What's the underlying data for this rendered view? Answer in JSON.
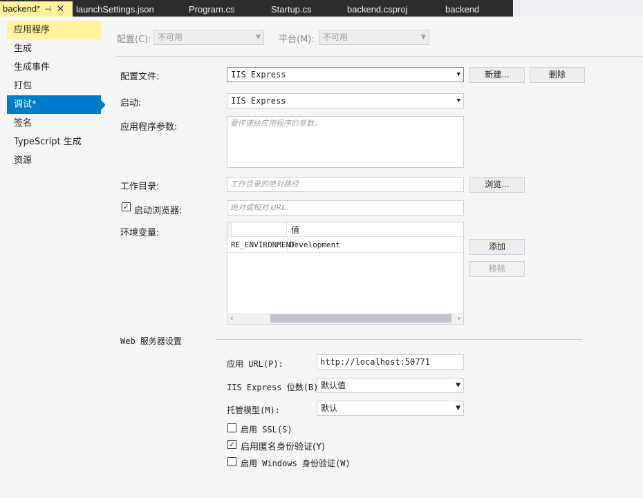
{
  "tabs": [
    {
      "label": "backend*",
      "active": true
    },
    {
      "label": "launchSettings.json"
    },
    {
      "label": "Program.cs"
    },
    {
      "label": "Startup.cs"
    },
    {
      "label": "backend.csproj"
    },
    {
      "label": "backend"
    }
  ],
  "tab_pin_glyph": "⊣",
  "tab_close_glyph": "✕",
  "nav": [
    "应用程序",
    "生成",
    "生成事件",
    "打包",
    "调试*",
    "签名",
    "TypeScript 生成",
    "资源"
  ],
  "config_bar": {
    "config_label": "配置(C):",
    "config_value": "不可用",
    "platform_label": "平台(M):",
    "platform_value": "不可用"
  },
  "profile": {
    "label": "配置文件:",
    "value": "IIS Express",
    "new_button": "新建...",
    "delete_button": "删除"
  },
  "launch": {
    "label": "启动:",
    "value": "IIS Express"
  },
  "app_args": {
    "label": "应用程序参数:",
    "placeholder": "要传递给应用程序的参数。"
  },
  "workdir": {
    "label": "工作目录:",
    "placeholder": "工作目录的绝对路径",
    "browse_button": "浏览..."
  },
  "browser": {
    "label": "启动浏览器:",
    "checked": true,
    "placeholder": "绝对或相对 URL"
  },
  "env": {
    "label": "环境变量:",
    "value_header": "值",
    "rows": [
      {
        "name": "RE_ENVIRONMENT",
        "value": "Development"
      }
    ],
    "add_button": "添加",
    "remove_button": "移除"
  },
  "web_section": {
    "title": "Web 服务器设置"
  },
  "app_url": {
    "label": "应用 URL(P):",
    "value": "http://localhost:50771"
  },
  "iis_bitness": {
    "label": "IIS Express 位数(B):",
    "value": "默认值"
  },
  "hosting_model": {
    "label": "托管模型(M):",
    "value": "默认"
  },
  "ssl": {
    "label": "启用 SSL(S)",
    "checked": false
  },
  "anon_auth": {
    "label": "启用匿名身份验证(Y)",
    "checked": true
  },
  "windows_auth": {
    "label": "启用 Windows 身份验证(W)",
    "checked": false
  },
  "colors": {
    "accent": "#007acc",
    "highlight": "#fff29d",
    "tabbar": "#2d2d30"
  }
}
